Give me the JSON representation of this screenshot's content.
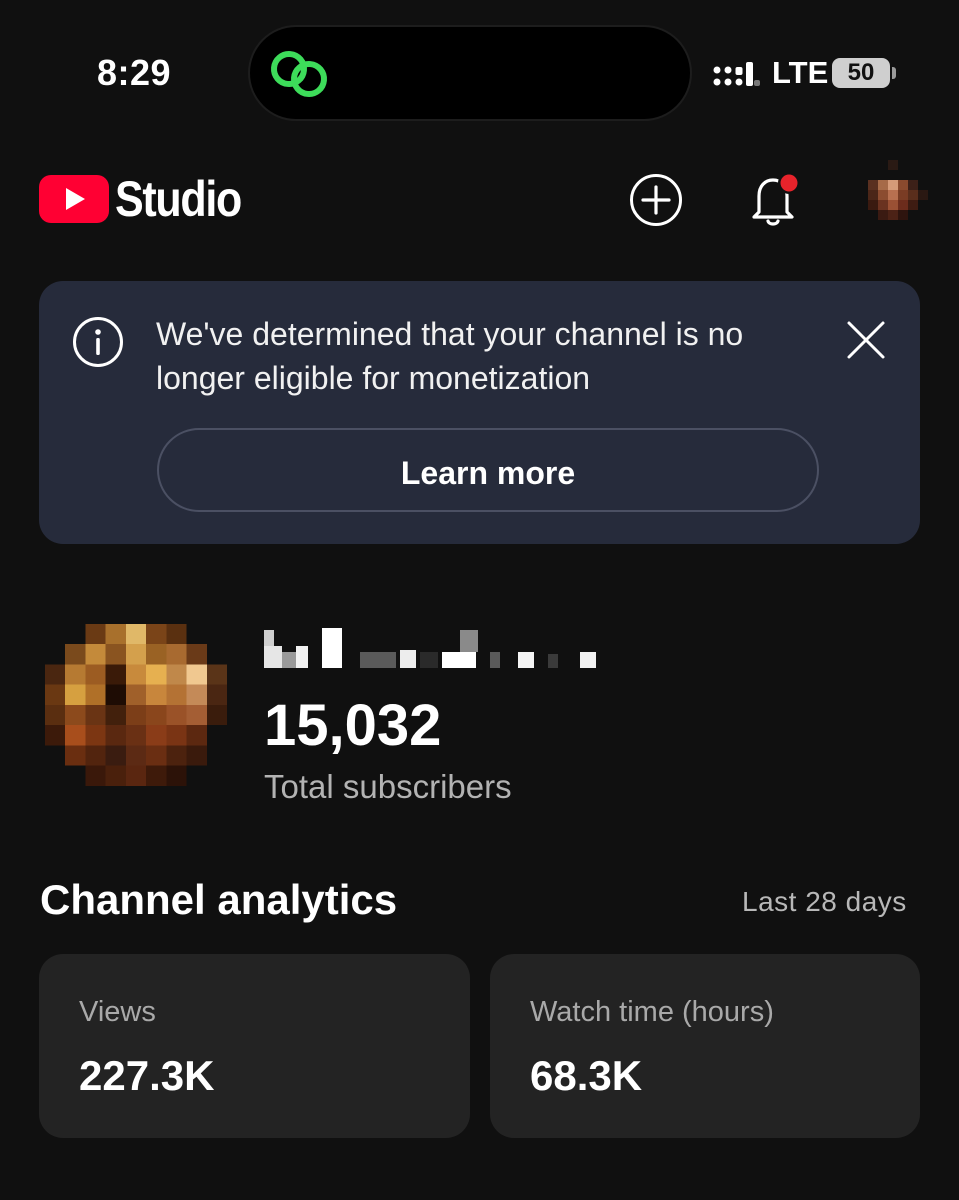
{
  "status_bar": {
    "time": "8:29",
    "network": "LTE",
    "battery": "50",
    "island_icon": "link-rings-icon"
  },
  "header": {
    "app_name": "Studio",
    "logo_icon": "youtube-play-icon",
    "create_icon": "plus-circle-icon",
    "notifications_icon": "bell-icon",
    "brand_color": "#FF0033"
  },
  "banner": {
    "message": "We've determined that your channel is no longer eligible for monetization",
    "button_label": "Learn more",
    "info_icon": "info-icon",
    "close_icon": "close-icon",
    "background_color": "#262B3B"
  },
  "channel": {
    "subscriber_count": "15,032",
    "subscriber_label": "Total subscribers"
  },
  "analytics": {
    "title": "Channel analytics",
    "period": "Last 28 days",
    "cards": [
      {
        "label": "Views",
        "value": "227.3K"
      },
      {
        "label": "Watch time (hours)",
        "value": "68.3K"
      }
    ]
  }
}
